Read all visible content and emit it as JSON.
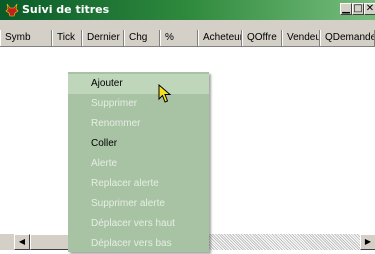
{
  "window": {
    "title": "Suivi de titres",
    "buttons": {
      "minimize": "▁",
      "maximize": "□",
      "close": "✕"
    },
    "colors": {
      "titlebar_start": "#0a5a2a",
      "titlebar_end": "#78bd7e",
      "frame": "#d4d0c8",
      "menu_bg": "#a8c2a4"
    }
  },
  "table": {
    "columns": [
      "Symb",
      "Tick",
      "Dernier",
      "Chg",
      "%",
      "Acheteur",
      "QOffre",
      "Vendeur",
      "QDemande"
    ],
    "rows": []
  },
  "context_menu": {
    "items": [
      {
        "label": "Ajouter",
        "enabled": true,
        "highlighted": true
      },
      {
        "label": "Supprimer",
        "enabled": false
      },
      {
        "label": "Renommer",
        "enabled": false
      },
      {
        "label": "Coller",
        "enabled": true
      },
      {
        "label": "Alerte",
        "enabled": false
      },
      {
        "label": "Replacer alerte",
        "enabled": false
      },
      {
        "label": "Supprimer alerte",
        "enabled": false
      },
      {
        "label": "Déplacer vers haut",
        "enabled": false
      },
      {
        "label": "Déplacer vers bas",
        "enabled": false
      }
    ]
  },
  "icons": {
    "app": "bull-icon",
    "cursor": "mouse-pointer-icon"
  }
}
